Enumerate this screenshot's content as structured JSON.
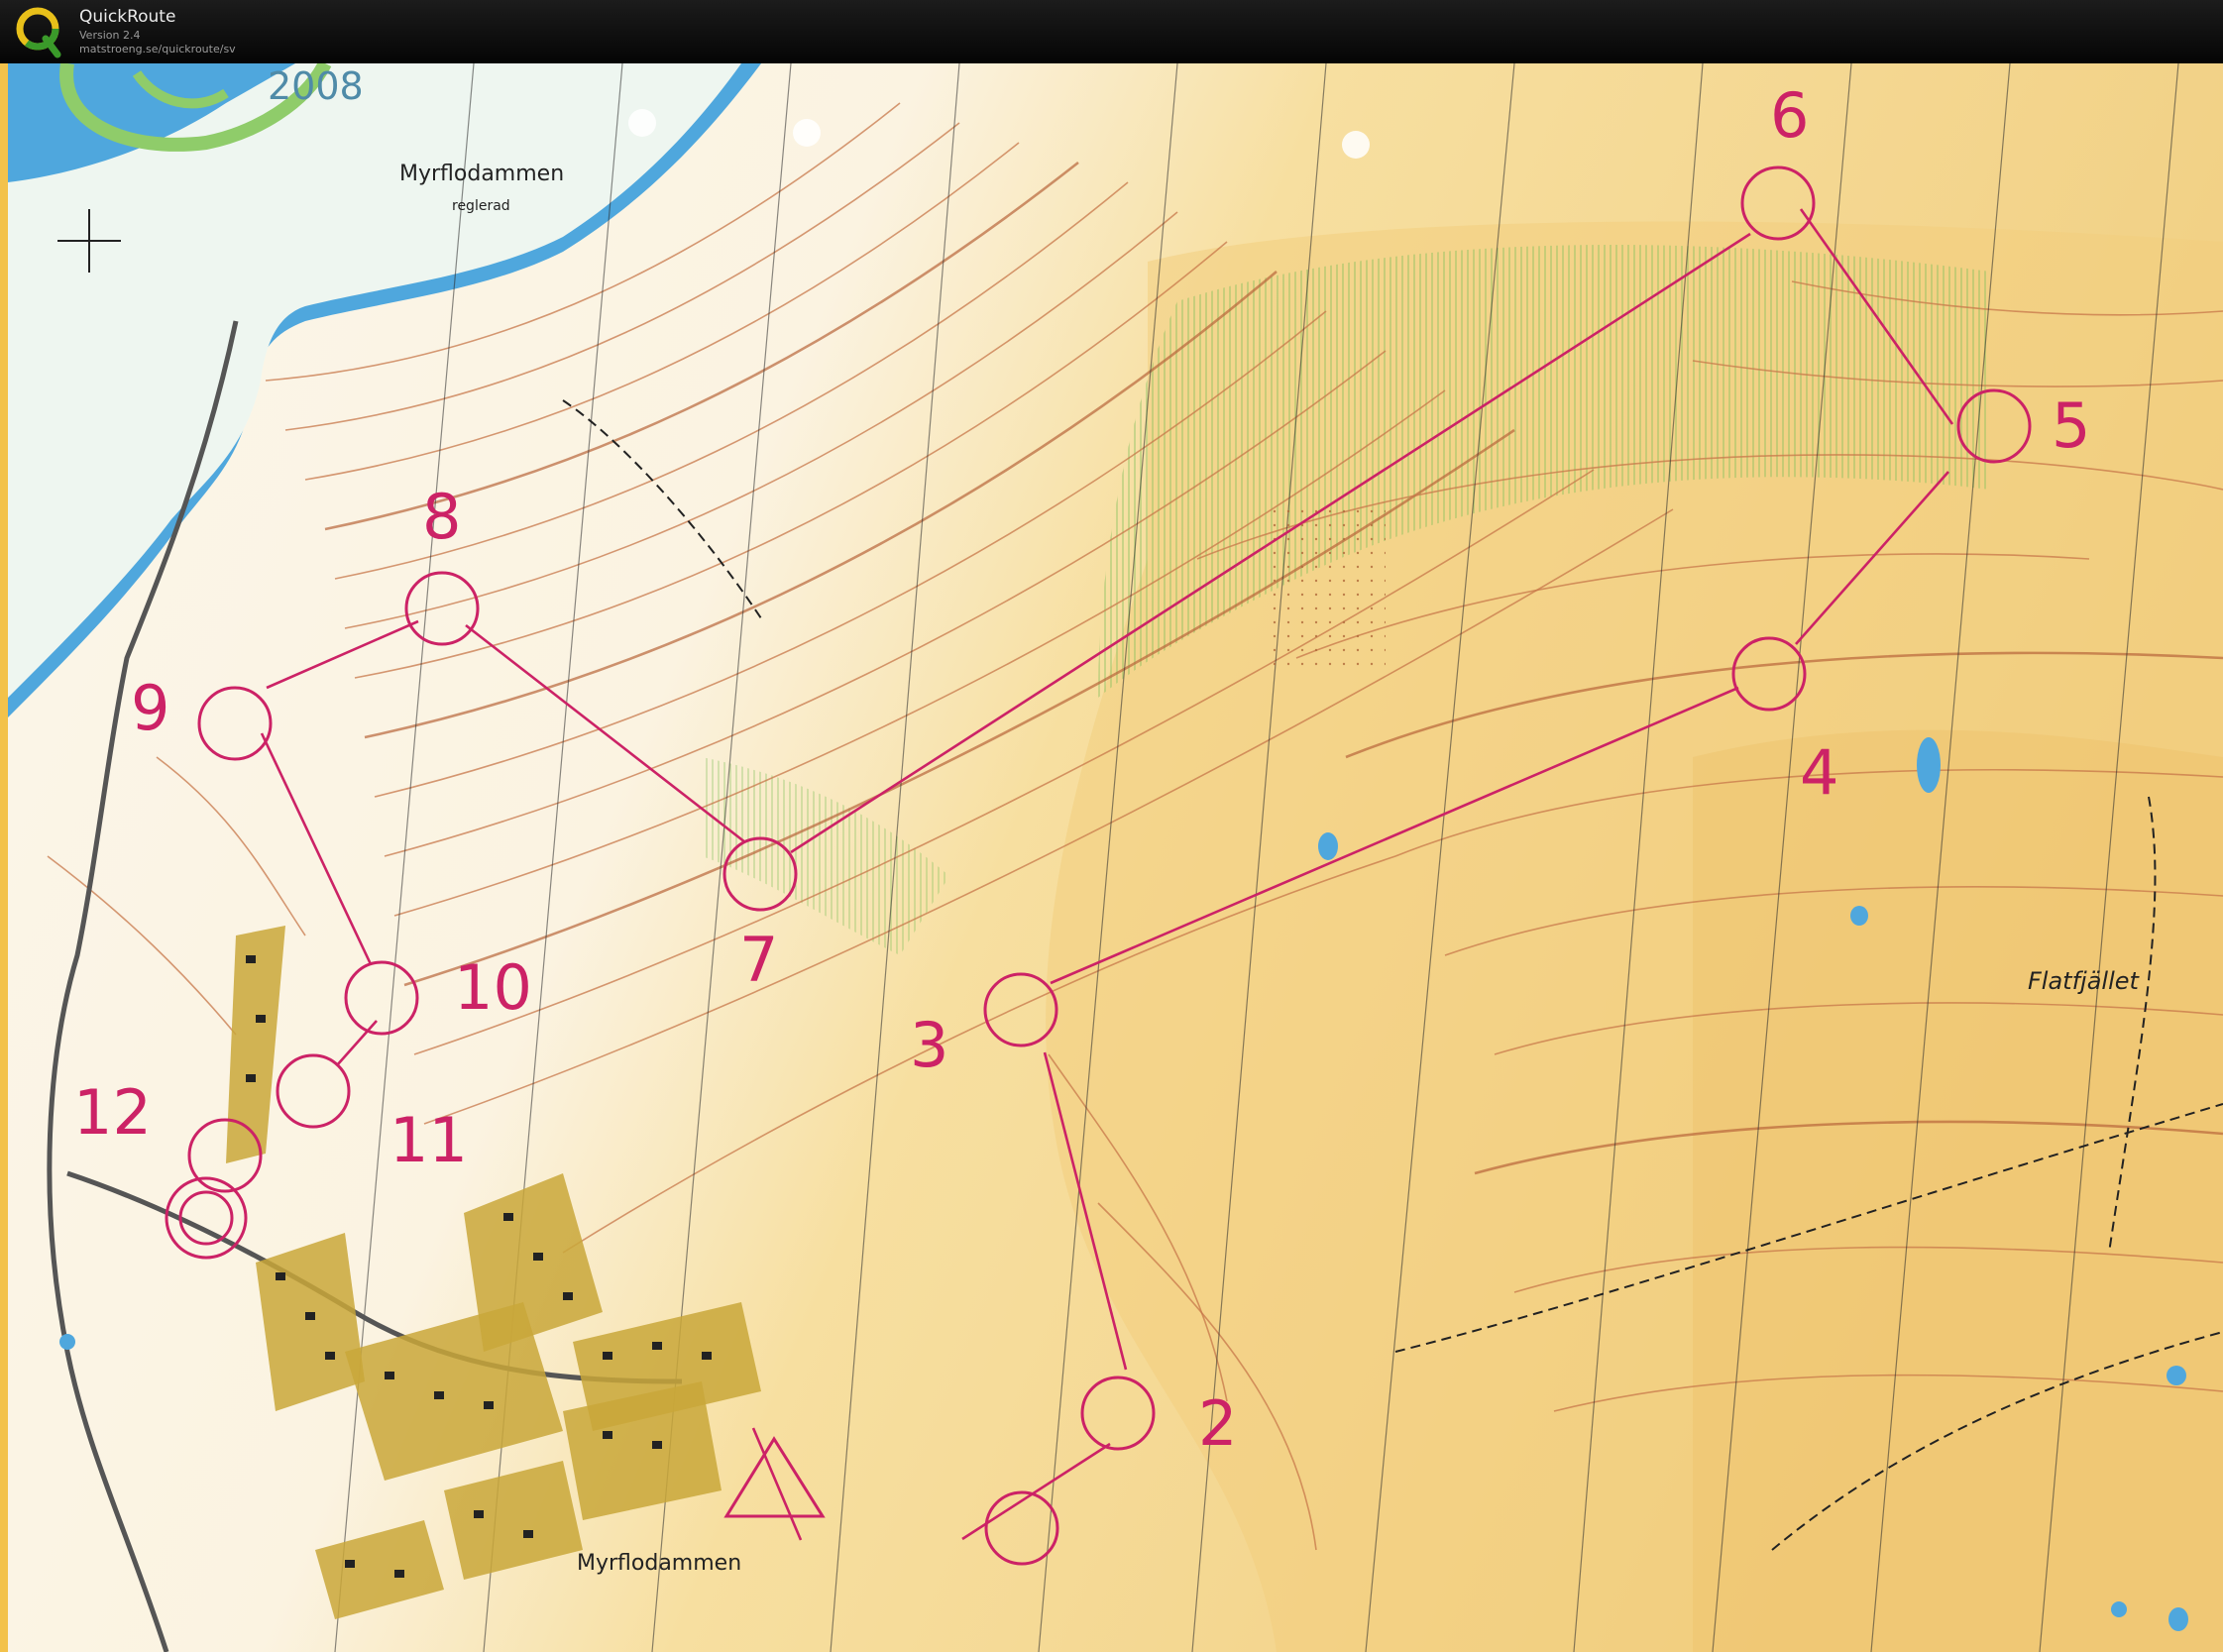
{
  "window": {
    "title": "QuickRoute",
    "version": "Version 2.4",
    "url": "matstroeng.se/quickroute/sv"
  },
  "map": {
    "year": "2008",
    "lake_name": "Myrflodammen",
    "lake_note": "reglerad",
    "bottom_label": "Myrflodammen",
    "mountain_name": "Flatfjället",
    "controls": [
      {
        "label": "2"
      },
      {
        "label": "3"
      },
      {
        "label": "4"
      },
      {
        "label": "5"
      },
      {
        "label": "6"
      },
      {
        "label": "7"
      },
      {
        "label": "8"
      },
      {
        "label": "9"
      },
      {
        "label": "10"
      },
      {
        "label": "11"
      },
      {
        "label": "12"
      }
    ]
  },
  "colors": {
    "course": "#cc2266",
    "water": "#4fa7dd",
    "open_land": "#f5d68a",
    "forest": "#fbf6ea"
  }
}
